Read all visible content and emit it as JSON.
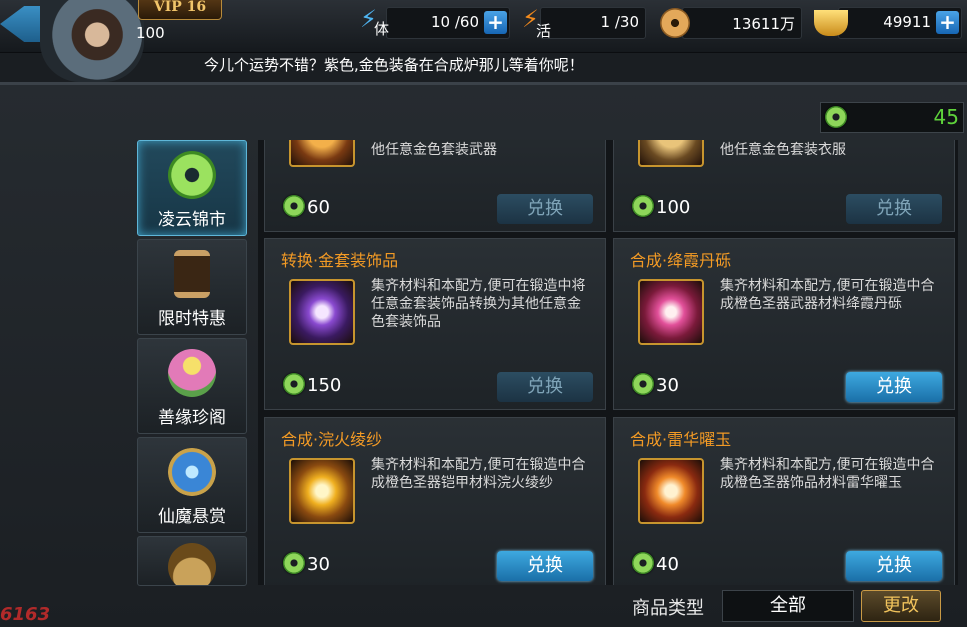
{
  "header": {
    "vip": "VIP 16",
    "level": "100",
    "stamina": {
      "label": "体",
      "value": "10 /60"
    },
    "vitality": {
      "label": "活",
      "value": "1 /30"
    },
    "coins": "13611万",
    "ingots": "49911"
  },
  "marquee": "今儿个运势不错？紫色,金色装备在合成炉那儿等着你呢！",
  "jade_balance": "45",
  "sidebar": {
    "items": [
      {
        "label": "凌云锦市",
        "active": true
      },
      {
        "label": "限时特惠",
        "active": false
      },
      {
        "label": "善缘珍阁",
        "active": false
      },
      {
        "label": "仙魔悬赏",
        "active": false
      }
    ]
  },
  "cards": [
    {
      "title": "",
      "desc": "他任意金色套装武器",
      "price": "60",
      "button": "兑换",
      "enabled": false
    },
    {
      "title": "",
      "desc": "他任意金色套装衣服",
      "price": "100",
      "button": "兑换",
      "enabled": false
    },
    {
      "title": "转换·金套装饰品",
      "desc": "集齐材料和本配方,便可在锻造中将任意金套装饰品转换为其他任意金色套装饰品",
      "price": "150",
      "button": "兑换",
      "enabled": false
    },
    {
      "title": "合成·绛霞丹砾",
      "desc": "集齐材料和本配方,便可在锻造中合成橙色圣器武器材料绛霞丹砾",
      "price": "30",
      "button": "兑换",
      "enabled": true
    },
    {
      "title": "合成·浣火绫纱",
      "desc": "集齐材料和本配方,便可在锻造中合成橙色圣器铠甲材料浣火绫纱",
      "price": "30",
      "button": "兑换",
      "enabled": true
    },
    {
      "title": "合成·雷华曜玉",
      "desc": "集齐材料和本配方,便可在锻造中合成橙色圣器饰品材料雷华曜玉",
      "price": "40",
      "button": "兑换",
      "enabled": true
    }
  ],
  "footer": {
    "type_label": "商品类型",
    "type_value": "全部",
    "change_button": "更改"
  },
  "watermark": "6163"
}
